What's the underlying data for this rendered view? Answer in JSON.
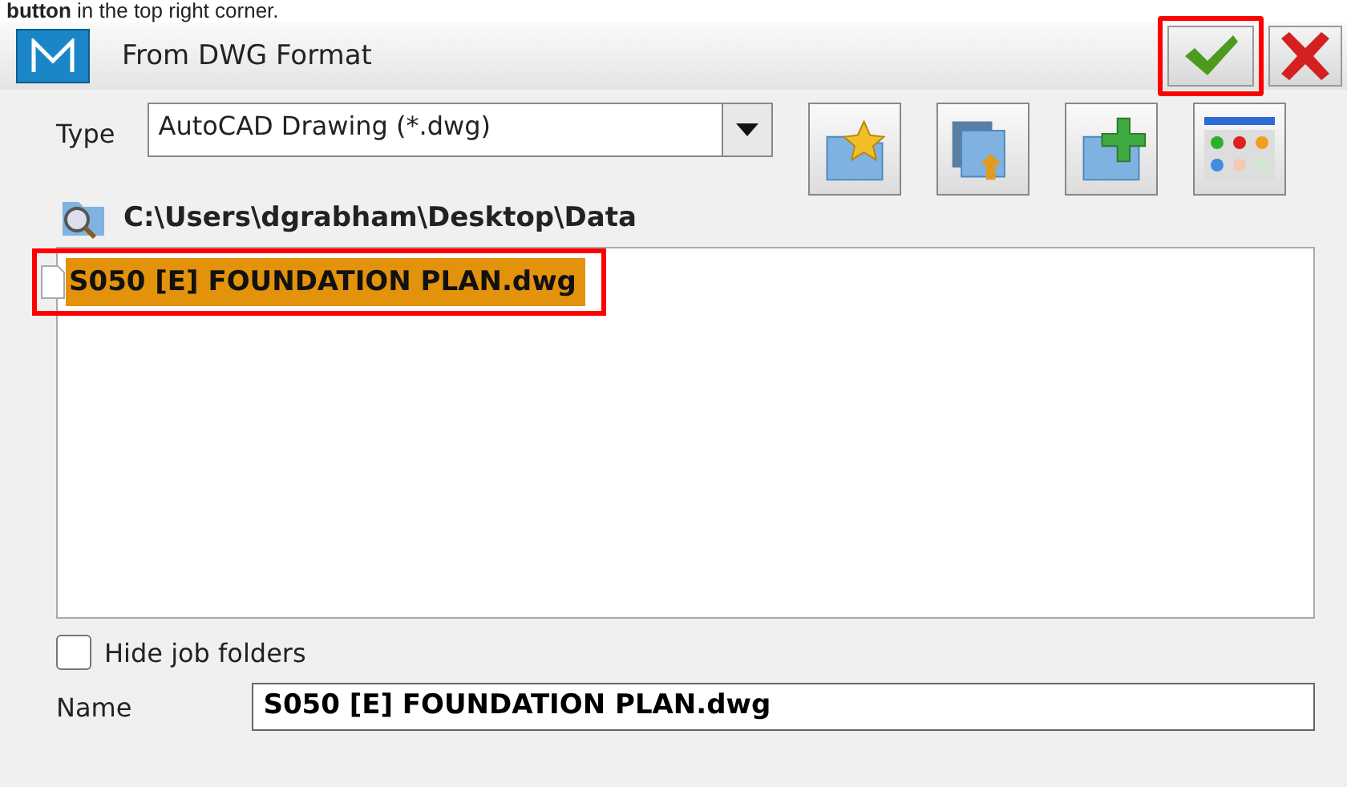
{
  "caption": "**button** in the top right corner.",
  "window": {
    "title": "From DWG Format",
    "ok_highlighted": true,
    "cancel_highlighted": false
  },
  "type_field": {
    "label": "Type",
    "value": "AutoCAD Drawing (*.dwg)"
  },
  "toolbar": [
    {
      "kind": "favorite"
    },
    {
      "kind": "recent"
    },
    {
      "kind": "new"
    },
    {
      "kind": "options"
    }
  ],
  "path": "C:\\Users\\dgrabham\\Desktop\\Data",
  "files": [
    {
      "name": "S050 [E] FOUNDATION PLAN.dwg",
      "selected": true,
      "highlighted": true
    }
  ],
  "hide_job_folders": {
    "label": "Hide job folders",
    "checked": false
  },
  "name_field": {
    "label": "Name",
    "value": "S050 [E] FOUNDATION PLAN.dwg"
  }
}
